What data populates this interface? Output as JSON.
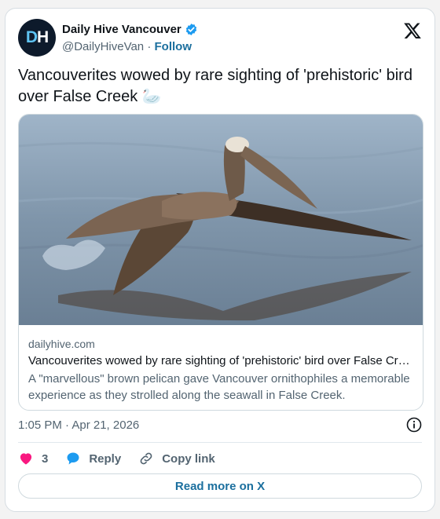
{
  "account": {
    "avatar_text_d": "D",
    "avatar_text_h": "H",
    "name": "Daily Hive Vancouver",
    "handle": "@DailyHiveVan",
    "separator": "·",
    "follow_label": "Follow"
  },
  "tweet": {
    "text": "Vancouverites wowed by rare sighting of 'prehistoric' bird over False Creek 🦢"
  },
  "link_card": {
    "domain": "dailyhive.com",
    "title": "Vancouverites wowed by rare sighting of 'prehistoric' bird over False Creek",
    "description": "A \"marvellous\" brown pelican gave Vancouver ornithophiles a memorable experience as they strolled along the seawall in False Creek."
  },
  "meta": {
    "timestamp": "1:05 PM · Apr 21, 2026"
  },
  "actions": {
    "like_count": "3",
    "reply_label": "Reply",
    "copy_label": "Copy link"
  },
  "read_more_label": "Read more on X",
  "icons": {
    "verified": "verified-badge-icon",
    "x_logo": "x-logo-icon",
    "info": "info-icon",
    "heart": "heart-icon",
    "reply": "reply-bubble-icon",
    "link": "link-icon"
  },
  "colors": {
    "accent": "#1b6f9e",
    "like": "#f91880",
    "reply": "#1d9bf0",
    "muted": "#536471"
  }
}
